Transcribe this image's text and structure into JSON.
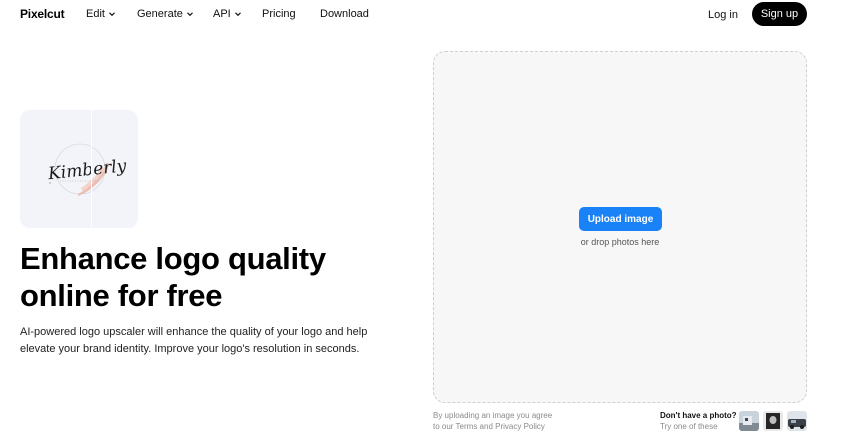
{
  "brand": {
    "name": "Pixelcut"
  },
  "nav": {
    "items": [
      {
        "label": "Edit",
        "has_dropdown": true
      },
      {
        "label": "Generate",
        "has_dropdown": true
      },
      {
        "label": "API",
        "has_dropdown": true
      },
      {
        "label": "Pricing",
        "has_dropdown": false
      },
      {
        "label": "Download",
        "has_dropdown": false
      }
    ],
    "login_label": "Log in",
    "signup_label": "Sign up"
  },
  "hero": {
    "preview_logo_text": "Kimberly",
    "title_line1": "Enhance logo quality",
    "title_line2": "online for free",
    "description_line1": "AI-powered logo upscaler will enhance the quality of your logo and help",
    "description_line2": "elevate your brand identity. Improve your logo's resolution in seconds."
  },
  "upload": {
    "button_label": "Upload image",
    "drop_hint": "or drop photos here",
    "legal_line1": "By uploading an image you agree",
    "legal_prefix": "to our ",
    "terms_label": "Terms",
    "legal_and": " and ",
    "privacy_label": "Privacy Policy",
    "no_photo_question": "Don't have a photo?",
    "no_photo_hint": "Try one of these"
  },
  "colors": {
    "accent": "#1a82f7",
    "signup_bg": "#000000",
    "dropzone_bg": "#f7f7f8",
    "logo_brush": "#e8b4a6"
  },
  "icons": [
    "chevron-down-icon"
  ]
}
